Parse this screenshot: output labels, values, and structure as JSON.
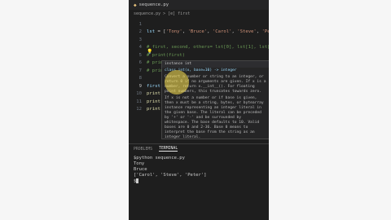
{
  "tab": {
    "filename": "sequence.py"
  },
  "breadcrumb": {
    "text": "sequence.py > [e] first"
  },
  "code_lines": [
    {
      "num": "1",
      "parts": []
    },
    {
      "num": "2",
      "parts": [
        {
          "cls": "var",
          "t": "lst"
        },
        {
          "cls": "code",
          "t": " = ["
        },
        {
          "cls": "str",
          "t": "'Tony'"
        },
        {
          "cls": "code",
          "t": ", "
        },
        {
          "cls": "str",
          "t": "'Bruce'"
        },
        {
          "cls": "code",
          "t": ", "
        },
        {
          "cls": "str",
          "t": "'Carol'"
        },
        {
          "cls": "code",
          "t": ", "
        },
        {
          "cls": "str",
          "t": "'Steve'"
        },
        {
          "cls": "code",
          "t": ", "
        },
        {
          "cls": "str",
          "t": "'Peter'"
        },
        {
          "cls": "code",
          "t": "]"
        }
      ]
    },
    {
      "num": "3",
      "parts": []
    },
    {
      "num": "4",
      "parts": [
        {
          "cls": "cmt",
          "t": "# first, second, others= lst[0], lst[1], lst[2:]"
        }
      ]
    },
    {
      "num": "5",
      "parts": [
        {
          "cls": "cmt",
          "t": "# print(first)"
        }
      ]
    },
    {
      "num": "6",
      "parts": [
        {
          "cls": "cmt",
          "t": "# print(second)"
        }
      ]
    },
    {
      "num": "7",
      "parts": [
        {
          "cls": "cmt",
          "t": "# print(others)"
        }
      ]
    },
    {
      "num": "8",
      "parts": []
    },
    {
      "num": "9",
      "parts": [
        {
          "cls": "var",
          "t": "first"
        },
        {
          "cls": "code",
          "t": ", "
        },
        {
          "cls": "var",
          "t": "others"
        },
        {
          "cls": "code",
          "t": ", "
        },
        {
          "cls": "var",
          "t": "last"
        },
        {
          "cls": "code",
          "t": "= "
        },
        {
          "cls": "var",
          "t": "lst"
        },
        {
          "cls": "code",
          "t": "["
        },
        {
          "cls": "num",
          "t": "0"
        },
        {
          "cls": "code",
          "t": "], "
        },
        {
          "cls": "sel",
          "t": "lst[1:-1]"
        },
        {
          "cls": "code",
          "t": ", lst[-1]"
        }
      ]
    },
    {
      "num": "10",
      "parts": [
        {
          "cls": "fn",
          "t": "print"
        },
        {
          "cls": "code",
          "t": "("
        }
      ]
    },
    {
      "num": "11",
      "parts": [
        {
          "cls": "fn",
          "t": "print"
        },
        {
          "cls": "code",
          "t": "("
        }
      ]
    },
    {
      "num": "12",
      "parts": [
        {
          "cls": "fn",
          "t": "print"
        },
        {
          "cls": "code",
          "t": "("
        }
      ]
    }
  ],
  "tooltip": {
    "head": "instance int",
    "signature": "class int(x, base=10) -> integer",
    "body1": "Convert a number or string to an integer, or return 0 if no arguments are given. If x is a number, return x.__int__(). For floating point numbers, this truncates towards zero.",
    "body2": "If x is not a number or if base is given, then x must be a string, bytes, or bytearray instance representing an integer literal in the given base. The literal can be preceded by '+' or '-' and be surrounded by whitespace. The base defaults to 10. Valid bases are 0 and 2-36. Base 0 means to interpret the base from the string as an integer literal."
  },
  "panel": {
    "tab_problems": "PROBLEMS",
    "tab_terminal": "TERMINAL"
  },
  "terminal": {
    "line1": "$python sequence.py",
    "line2": "Tony",
    "line3": "Bruce",
    "line4": "['Carol', 'Steve', 'Peter']",
    "line5": "$"
  }
}
